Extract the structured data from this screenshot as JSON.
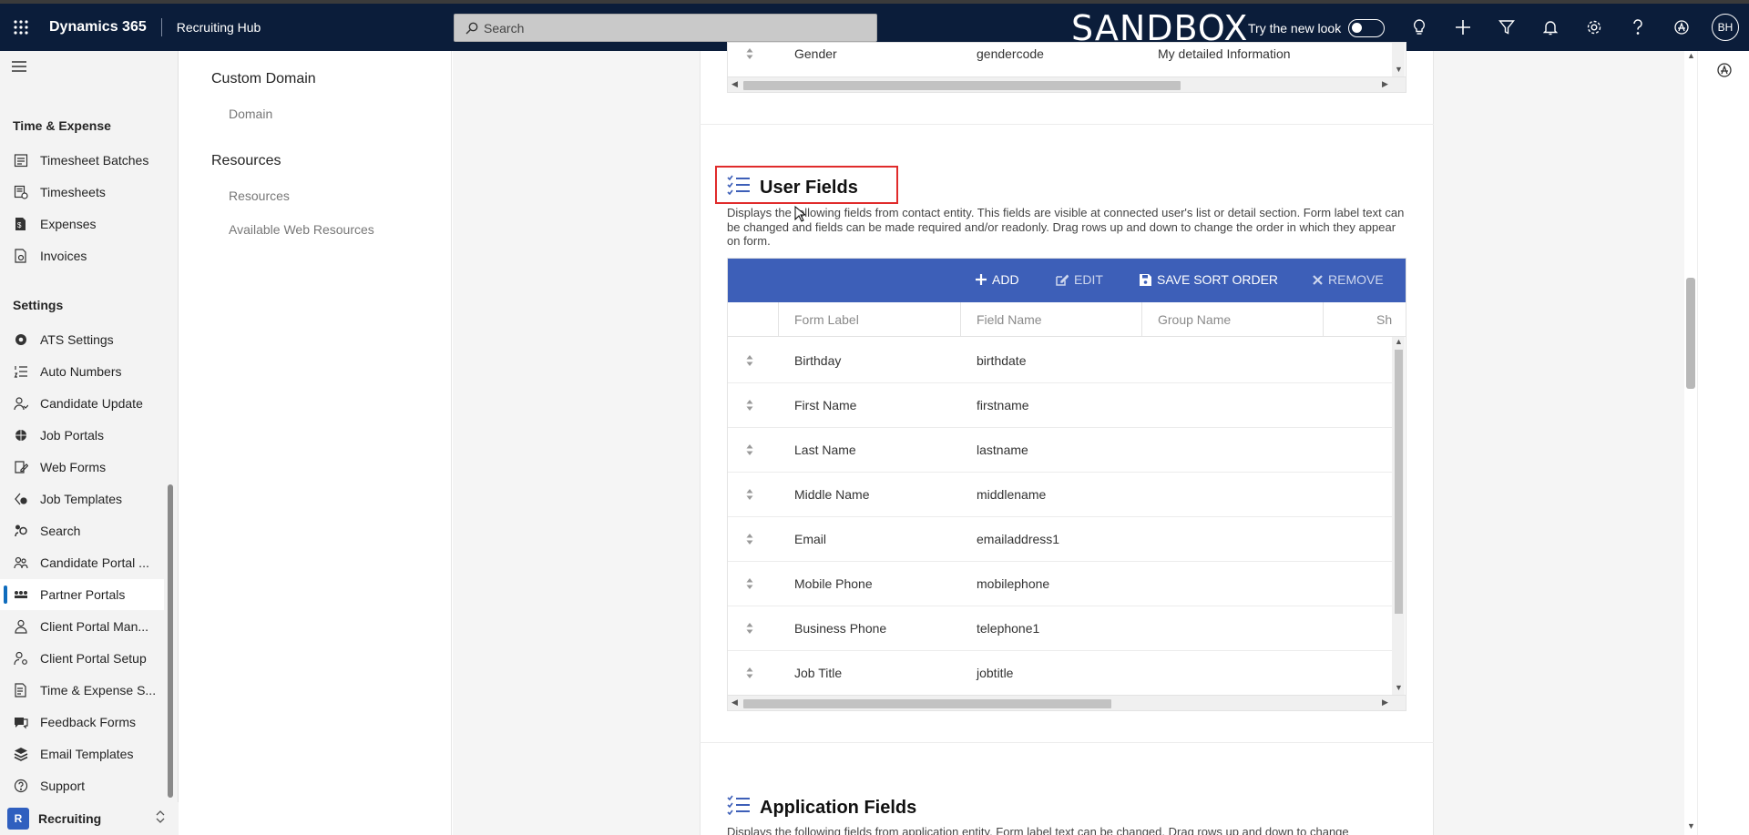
{
  "topbar": {
    "app_name": "Dynamics 365",
    "area_name": "Recruiting Hub",
    "search_placeholder": "Search",
    "environment": "SANDBOX",
    "try_new_look": "Try the new look",
    "avatar_initials": "BH"
  },
  "sidebar": {
    "groups": [
      {
        "label": "Time & Expense"
      },
      {
        "label": "Settings"
      }
    ],
    "items": [
      {
        "label": "Timesheet Batches",
        "icon": "calendar-list-icon"
      },
      {
        "label": "Timesheets",
        "icon": "timesheet-icon"
      },
      {
        "label": "Expenses",
        "icon": "expense-doc-icon"
      },
      {
        "label": "Invoices",
        "icon": "invoice-icon"
      },
      {
        "label": "ATS Settings",
        "icon": "gear-icon"
      },
      {
        "label": "Auto Numbers",
        "icon": "numbered-list-icon"
      },
      {
        "label": "Candidate Update",
        "icon": "people-icon"
      },
      {
        "label": "Job Portals",
        "icon": "globe-icon"
      },
      {
        "label": "Web Forms",
        "icon": "form-edit-icon"
      },
      {
        "label": "Job Templates",
        "icon": "template-icon"
      },
      {
        "label": "Search",
        "icon": "search-people-icon"
      },
      {
        "label": "Candidate Portal ...",
        "icon": "people-icon"
      },
      {
        "label": "Partner Portals",
        "icon": "partners-icon"
      },
      {
        "label": "Client Portal Man...",
        "icon": "person-icon"
      },
      {
        "label": "Client Portal Setup",
        "icon": "person-settings-icon"
      },
      {
        "label": "Time & Expense S...",
        "icon": "document-icon"
      },
      {
        "label": "Feedback Forms",
        "icon": "feedback-icon"
      },
      {
        "label": "Email Templates",
        "icon": "layers-icon"
      },
      {
        "label": "Support",
        "icon": "help-circle-icon"
      }
    ],
    "area_switcher": {
      "badge": "R",
      "label": "Recruiting"
    }
  },
  "subnav": {
    "sections": [
      {
        "heading": "Custom Domain",
        "links": [
          "Domain"
        ]
      },
      {
        "heading": "Resources",
        "links": [
          "Resources",
          "Available Web Resources"
        ]
      }
    ]
  },
  "top_grid": {
    "row": {
      "label": "Gender",
      "field": "gendercode",
      "group": "My detailed Information"
    }
  },
  "user_fields": {
    "title": "User Fields",
    "description": "Displays the following fields from contact entity. This fields are visible at connected user's list or detail section. Form label text can be changed and fields can be made required and/or readonly. Drag rows up and down to change the order in which they appear on form.",
    "toolbar": {
      "add": "ADD",
      "edit": "EDIT",
      "save_sort": "SAVE SORT ORDER",
      "remove": "REMOVE"
    },
    "columns": [
      "Form Label",
      "Field Name",
      "Group Name",
      "Sh"
    ],
    "rows": [
      {
        "label": "Birthday",
        "field": "birthdate",
        "group": ""
      },
      {
        "label": "First Name",
        "field": "firstname",
        "group": ""
      },
      {
        "label": "Last Name",
        "field": "lastname",
        "group": ""
      },
      {
        "label": "Middle Name",
        "field": "middlename",
        "group": ""
      },
      {
        "label": "Email",
        "field": "emailaddress1",
        "group": ""
      },
      {
        "label": "Mobile Phone",
        "field": "mobilephone",
        "group": ""
      },
      {
        "label": "Business Phone",
        "field": "telephone1",
        "group": ""
      },
      {
        "label": "Job Title",
        "field": "jobtitle",
        "group": ""
      }
    ]
  },
  "application_fields": {
    "title": "Application Fields",
    "description": "Displays the following fields from application entity. Form label text can be changed. Drag rows up and down to change"
  }
}
